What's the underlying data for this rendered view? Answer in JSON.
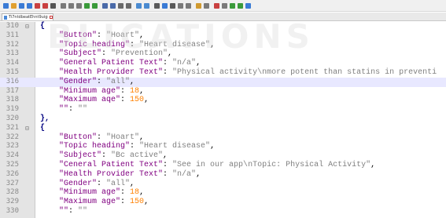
{
  "toolbar": {
    "icons": [
      "new-file-icon",
      "open-file-icon",
      "save-icon",
      "save-all-icon",
      "close-icon",
      "close-all-icon",
      "print-icon",
      "cut-icon",
      "copy-icon",
      "paste-icon",
      "undo-icon",
      "redo-icon",
      "find-icon",
      "replace-icon",
      "zoom-in-icon",
      "zoom-out-icon",
      "sync-v-icon",
      "sync-h-icon",
      "word-wrap-icon",
      "show-all-chars-icon",
      "indent-guide-icon",
      "doc-map-icon",
      "function-list-icon",
      "folder-workspace-icon",
      "monitor-icon",
      "record-macro-icon",
      "stop-macro-icon",
      "play-macro-icon",
      "run-macro-icon",
      "save-macro-icon"
    ],
    "icon_colors": [
      "#3a7bd5",
      "#e0a030",
      "#3a7bd5",
      "#3a7bd5",
      "#c94040",
      "#c94040",
      "#555555",
      "#7a7a7a",
      "#7a7a7a",
      "#7a7a7a",
      "#3a9a3a",
      "#3a9a3a",
      "#4a6aa8",
      "#4a6aa8",
      "#6a6a6a",
      "#6a6a6a",
      "#4a8ad0",
      "#4a8ad0",
      "#5a5a5a",
      "#3a7bd5",
      "#5a5a5a",
      "#7a7a7a",
      "#7a7a7a",
      "#d09a30",
      "#7a7a7a",
      "#c94040",
      "#7a7a7a",
      "#3a9a3a",
      "#3a9a3a",
      "#3a7bd5"
    ]
  },
  "tab": {
    "label": "Ti7ntdbeatEhnt9uigs.json"
  },
  "watermark": {
    "text": "BLICATIONS"
  },
  "editor": {
    "lines": [
      {
        "num": "310",
        "fold": "⊟",
        "parts": [
          [
            "p",
            "{"
          ]
        ]
      },
      {
        "num": "311",
        "fold": "",
        "parts": [
          [
            "k",
            "    \"Button\""
          ],
          [
            "t",
            ": "
          ],
          [
            "s",
            "\"Hoart\""
          ],
          [
            "t",
            ","
          ]
        ]
      },
      {
        "num": "312",
        "fold": "",
        "parts": [
          [
            "k",
            "    \"Topic heading\""
          ],
          [
            "t",
            ": "
          ],
          [
            "s",
            "\"Heart disease\""
          ],
          [
            "t",
            ","
          ]
        ]
      },
      {
        "num": "313",
        "fold": "",
        "parts": [
          [
            "k",
            "    \"Subject\""
          ],
          [
            "t",
            ": "
          ],
          [
            "s",
            "\"Prevention\""
          ],
          [
            "t",
            ","
          ]
        ]
      },
      {
        "num": "314",
        "fold": "",
        "parts": [
          [
            "k",
            "    \"General Patient Text\""
          ],
          [
            "t",
            ": "
          ],
          [
            "s",
            "\"n/a\""
          ],
          [
            "t",
            ","
          ]
        ]
      },
      {
        "num": "315",
        "fold": "",
        "parts": [
          [
            "k",
            "    \"Health Provider Text\""
          ],
          [
            "t",
            ": "
          ],
          [
            "s",
            "\"Physical activity\\nmore potent than statins in preventi"
          ]
        ]
      },
      {
        "num": "316",
        "fold": "",
        "hl": true,
        "parts": [
          [
            "k",
            "    \"Gender\""
          ],
          [
            "t",
            ": "
          ],
          [
            "s",
            "\"all\""
          ],
          [
            "t",
            ","
          ]
        ]
      },
      {
        "num": "317",
        "fold": "",
        "parts": [
          [
            "k",
            "    \"Minimum age\""
          ],
          [
            "t",
            ": "
          ],
          [
            "n",
            "18"
          ],
          [
            "t",
            ","
          ]
        ]
      },
      {
        "num": "318",
        "fold": "",
        "parts": [
          [
            "k",
            "    \"Maximum aqe\""
          ],
          [
            "t",
            ": "
          ],
          [
            "n",
            "150"
          ],
          [
            "t",
            ","
          ]
        ]
      },
      {
        "num": "319",
        "fold": "",
        "parts": [
          [
            "k",
            "    \"\""
          ],
          [
            "t",
            ": "
          ],
          [
            "s",
            "\"\""
          ]
        ]
      },
      {
        "num": "320",
        "fold": "",
        "parts": [
          [
            "p",
            "},"
          ]
        ]
      },
      {
        "num": "321",
        "fold": "⊟",
        "parts": [
          [
            "p",
            "{"
          ]
        ]
      },
      {
        "num": "322",
        "fold": "",
        "parts": [
          [
            "k",
            "    \"Button\""
          ],
          [
            "t",
            ": "
          ],
          [
            "s",
            "\"Hoart\""
          ],
          [
            "t",
            ","
          ]
        ]
      },
      {
        "num": "323",
        "fold": "",
        "parts": [
          [
            "k",
            "    \"Topic heading\""
          ],
          [
            "t",
            ": "
          ],
          [
            "s",
            "\"Heart disease\""
          ],
          [
            "t",
            ","
          ]
        ]
      },
      {
        "num": "324",
        "fold": "",
        "parts": [
          [
            "k",
            "    \"Subject\""
          ],
          [
            "t",
            ": "
          ],
          [
            "s",
            "\"Bc active\""
          ],
          [
            "t",
            ","
          ]
        ]
      },
      {
        "num": "325",
        "fold": "",
        "parts": [
          [
            "k",
            "    \"Ceneral Patient Text\""
          ],
          [
            "t",
            ": "
          ],
          [
            "s",
            "\"See in our app\\nTopic: Physical Activity\""
          ],
          [
            "t",
            ","
          ]
        ]
      },
      {
        "num": "326",
        "fold": "",
        "parts": [
          [
            "k",
            "    \"Health Provider Text\""
          ],
          [
            "t",
            ": "
          ],
          [
            "s",
            "\"n/a\""
          ],
          [
            "t",
            ","
          ]
        ]
      },
      {
        "num": "327",
        "fold": "",
        "parts": [
          [
            "k",
            "    \"Gender\""
          ],
          [
            "t",
            ": "
          ],
          [
            "s",
            "\"all\""
          ],
          [
            "t",
            ","
          ]
        ]
      },
      {
        "num": "328",
        "fold": "",
        "parts": [
          [
            "k",
            "    \"Minimum age\""
          ],
          [
            "t",
            ": "
          ],
          [
            "n",
            "18"
          ],
          [
            "t",
            ","
          ]
        ]
      },
      {
        "num": "329",
        "fold": "",
        "parts": [
          [
            "k",
            "    \"Maximum age\""
          ],
          [
            "t",
            ": "
          ],
          [
            "n",
            "150"
          ],
          [
            "t",
            ","
          ]
        ]
      },
      {
        "num": "330",
        "fold": "",
        "parts": [
          [
            "k",
            "    \"\""
          ],
          [
            "t",
            ": "
          ],
          [
            "s",
            "\"\""
          ]
        ]
      }
    ]
  }
}
